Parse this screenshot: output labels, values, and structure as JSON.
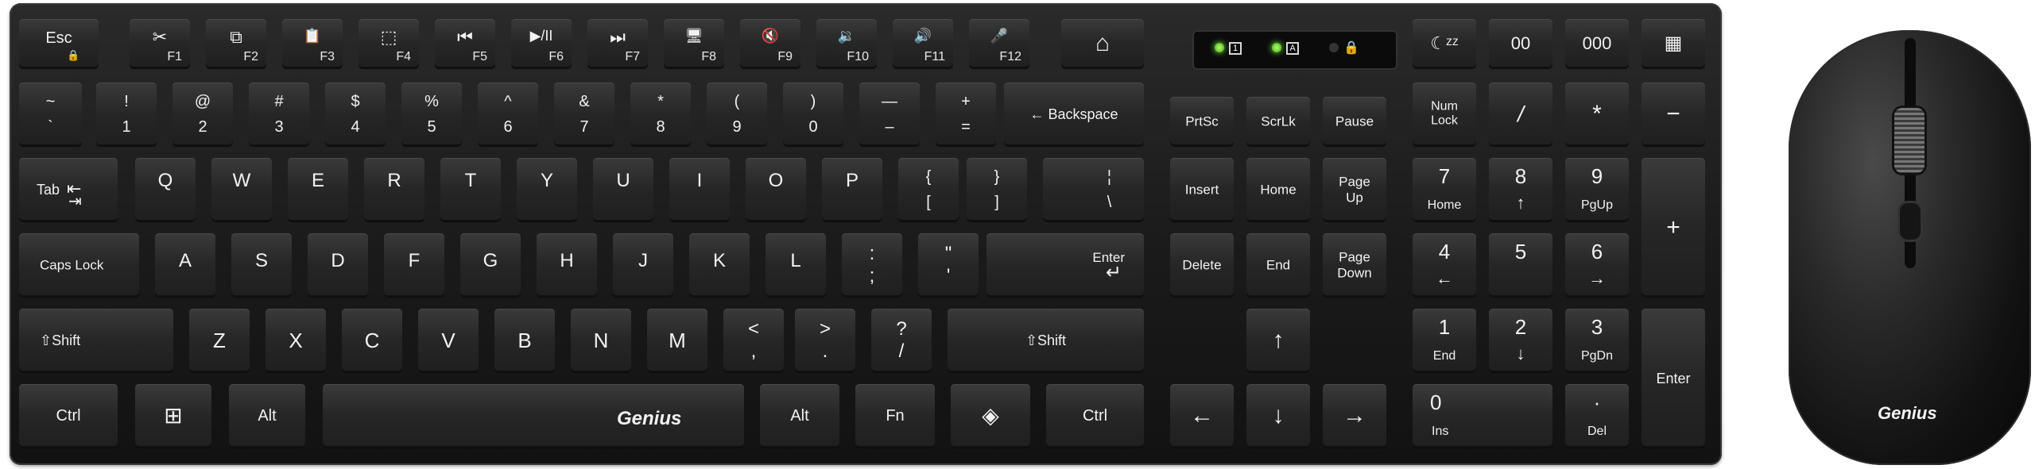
{
  "keyboard": {
    "brand": "Genius",
    "fn_row": [
      {
        "id": "esc",
        "top": "Esc",
        "sub": "🔒"
      },
      {
        "id": "f1",
        "icon": "✂",
        "f": "F1"
      },
      {
        "id": "f2",
        "icon": "⧉",
        "f": "F2"
      },
      {
        "id": "f3",
        "icon": "📋",
        "f": "F3"
      },
      {
        "id": "f4",
        "icon": "⬚",
        "f": "F4"
      },
      {
        "id": "f5",
        "icon": "⏮",
        "f": "F5"
      },
      {
        "id": "f6",
        "icon": "▶/II",
        "f": "F6"
      },
      {
        "id": "f7",
        "icon": "⏭",
        "f": "F7"
      },
      {
        "id": "f8",
        "icon": "🖥",
        "f": "F8"
      },
      {
        "id": "f9",
        "icon": "🔇",
        "f": "F9"
      },
      {
        "id": "f10",
        "icon": "🔉",
        "f": "F10"
      },
      {
        "id": "f11",
        "icon": "🔊",
        "f": "F11"
      },
      {
        "id": "f12",
        "icon": "🎤",
        "f": "F12"
      },
      {
        "id": "home",
        "icon": "⌂"
      }
    ],
    "indicators": {
      "num": "1",
      "caps": "A",
      "lock": "🔒"
    },
    "numrow": [
      [
        "~",
        "`"
      ],
      [
        "!",
        "1"
      ],
      [
        "@",
        "2"
      ],
      [
        "#",
        "3"
      ],
      [
        "$",
        "4"
      ],
      [
        "%",
        "5"
      ],
      [
        "^",
        "6"
      ],
      [
        "&",
        "7"
      ],
      [
        "*",
        "8"
      ],
      [
        "(",
        "9"
      ],
      [
        ")",
        "0"
      ],
      [
        "—",
        "–"
      ],
      [
        "+",
        "="
      ]
    ],
    "backspace": "← Backspace",
    "tab": "Tab",
    "qrow": [
      "Q",
      "W",
      "E",
      "R",
      "T",
      "Y",
      "U",
      "I",
      "O",
      "P"
    ],
    "brackets": [
      [
        "{",
        "["
      ],
      [
        "}",
        "]"
      ],
      [
        "¦",
        "\\"
      ]
    ],
    "capslock": "Caps Lock",
    "arow": [
      "A",
      "S",
      "D",
      "F",
      "G",
      "H",
      "J",
      "K",
      "L"
    ],
    "colon": [
      ":",
      ";"
    ],
    "quote": [
      "\"",
      "'"
    ],
    "enter": "Enter",
    "shift": "⇧Shift",
    "zrow": [
      "Z",
      "X",
      "C",
      "V",
      "B",
      "N",
      "M"
    ],
    "lt": [
      "<",
      ","
    ],
    "gt": [
      ">",
      "."
    ],
    "slash": [
      "?",
      "/"
    ],
    "ctrl": "Ctrl",
    "win": "⊞",
    "alt": "Alt",
    "fn": "Fn",
    "copilot": "◈",
    "nav": {
      "prtsc": "PrtSc",
      "scrlk": "ScrLk",
      "pause": "Pause",
      "insert": "Insert",
      "home": "Home",
      "pageup": [
        "Page",
        "Up"
      ],
      "delete": "Delete",
      "end": "End",
      "pagedown": [
        "Page",
        "Down"
      ]
    },
    "arrows": {
      "up": "↑",
      "down": "↓",
      "left": "←",
      "right": "→"
    },
    "numpad": {
      "sleep": "☾ᶻᶻ",
      "k00": "00",
      "k000": "000",
      "calc": "▦",
      "numlock": [
        "Num",
        "Lock"
      ],
      "div": "/",
      "mul": "*",
      "minus": "−",
      "plus": "+",
      "n7": [
        "7",
        "Home"
      ],
      "n8": [
        "8",
        "↑"
      ],
      "n9": [
        "9",
        "PgUp"
      ],
      "n4": [
        "4",
        "←"
      ],
      "n5": [
        "5",
        ""
      ],
      "n6": [
        "6",
        "→"
      ],
      "n1": [
        "1",
        "End"
      ],
      "n2": [
        "2",
        "↓"
      ],
      "n3": [
        "3",
        "PgDn"
      ],
      "n0": [
        "0",
        "Ins"
      ],
      "dot": [
        "·",
        "Del"
      ],
      "enter": "Enter"
    }
  },
  "mouse": {
    "brand": "Genius"
  }
}
